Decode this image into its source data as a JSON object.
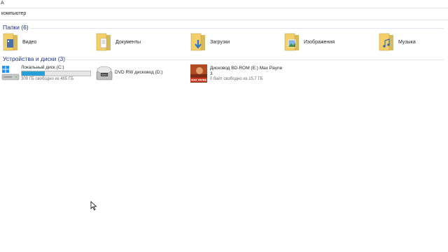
{
  "window": {
    "top_char": "А"
  },
  "address": {
    "text": "компьютер"
  },
  "folders": {
    "header": "Папки (6)",
    "items": [
      {
        "label": "Видео",
        "icon": "video-folder-icon"
      },
      {
        "label": "Документы",
        "icon": "documents-folder-icon"
      },
      {
        "label": "Загрузки",
        "icon": "downloads-folder-icon"
      },
      {
        "label": "Изображения",
        "icon": "pictures-folder-icon"
      },
      {
        "label": "Музыка",
        "icon": "music-folder-icon"
      }
    ]
  },
  "devices": {
    "header": "Устройства и диски (3)",
    "items": [
      {
        "name": "Локальный диск (C:)",
        "free": "309 ГБ свободно из 465 ГБ",
        "usage_fraction": 0.34,
        "icon": "local-disk-icon"
      },
      {
        "name": "DVD RW дисковод (D:)",
        "icon": "dvd-drive-icon"
      },
      {
        "name_line1": "Дисковод BD-ROM (E:) Max Payne",
        "name_line2": "3",
        "free": "0 байт свободно из 15,7 ГБ",
        "icon": "max-payne-disc-icon",
        "disc_label": "MAX PAYNE"
      }
    ]
  },
  "colors": {
    "header": "#1e3287",
    "usage_fill": "#26a0da",
    "folder_yellow": "#f3cf6a"
  }
}
